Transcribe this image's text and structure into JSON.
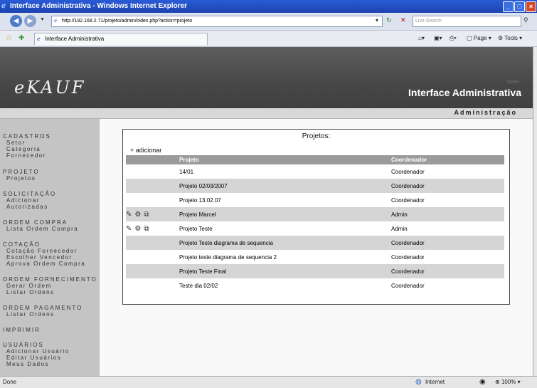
{
  "window": {
    "title": "Interface Administrativa - Windows Internet Explorer"
  },
  "browser": {
    "address": "http://192.168.2.71/projeto/admin/index.php?action=projeto",
    "search_placeholder": "Live Search",
    "tab_title": "Interface Administrativa",
    "commands": {
      "page": "Page",
      "tools": "Tools"
    }
  },
  "header": {
    "logo": "eKAUF",
    "app_title": "Interface Administrativa",
    "admin_label": "Administração"
  },
  "sidebar": {
    "sections": [
      {
        "title": "CADASTROS",
        "items": [
          "Setor",
          "Categoria",
          "Fornecedor"
        ]
      },
      {
        "title": "PROJETO",
        "items": [
          "Projetos"
        ]
      },
      {
        "title": "SOLICITAÇÃO",
        "items": [
          "Adicionar",
          "Autorizadas"
        ]
      },
      {
        "title": "ORDEM COMPRA",
        "items": [
          "Lista Ordem Compra"
        ]
      },
      {
        "title": "COTAÇÃO",
        "items": [
          "Cotação Fornecedor",
          "Escolher Vencedor",
          "Aprova Ordem Compra"
        ]
      },
      {
        "title": "ORDEM FORNECIMENTO",
        "items": [
          "Gerar Ordem",
          "Listar Ordens"
        ]
      },
      {
        "title": "ORDEM PAGAMENTO",
        "items": [
          "Listar Ordens"
        ]
      },
      {
        "title": "IMPRIMIR",
        "items": []
      },
      {
        "title": "USUÁRIOS",
        "items": [
          "Adicionar Usuário",
          "Editar Usuários",
          "Meus Dados"
        ]
      }
    ]
  },
  "main": {
    "panel_title": "Projetos:",
    "add_link": "+ adicionar",
    "columns": {
      "project": "Projeto",
      "coordinator": "Coordenador"
    },
    "rows": [
      {
        "project": "14/01",
        "coordinator": "Coordenador",
        "actions": false
      },
      {
        "project": "Projeto 02/03/2007",
        "coordinator": "Coordenador",
        "actions": false
      },
      {
        "project": "Projeto 13.02.07",
        "coordinator": "Coordenador",
        "actions": false
      },
      {
        "project": "Projeto Marcel",
        "coordinator": "Admin",
        "actions": true
      },
      {
        "project": "Projeto Teste",
        "coordinator": "Admin",
        "actions": true
      },
      {
        "project": "Projeto Teste diagrama de sequencia",
        "coordinator": "Coordenador",
        "actions": false
      },
      {
        "project": "Projeto teste diagrama de sequencia 2",
        "coordinator": "Coordenador",
        "actions": false
      },
      {
        "project": "Projeto Teste Final",
        "coordinator": "Coordenador",
        "actions": false
      },
      {
        "project": "Teste dia 02/02",
        "coordinator": "Coordenador",
        "actions": false
      }
    ]
  },
  "status": {
    "left": "Done",
    "zone": "Internet",
    "zoom": "100%"
  },
  "icons": {
    "edit": "edit-icon",
    "members": "members-icon",
    "copy": "copy-icon"
  }
}
